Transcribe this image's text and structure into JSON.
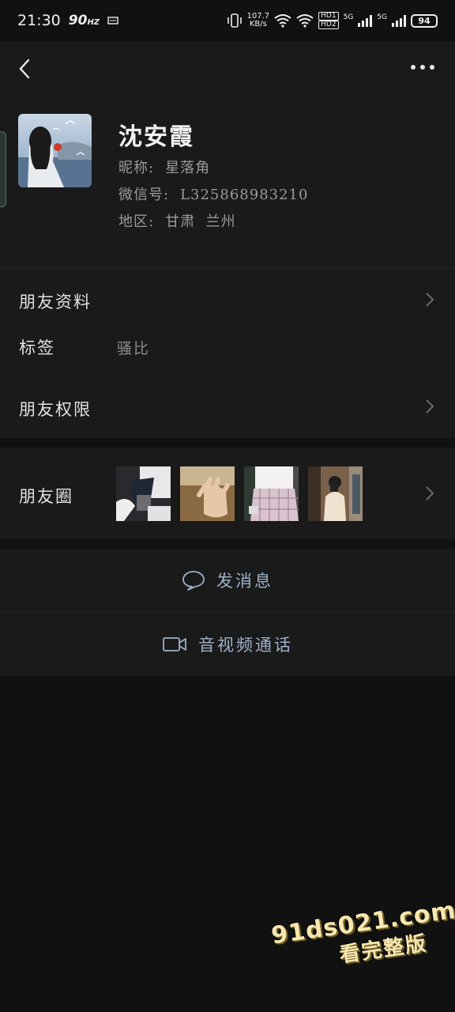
{
  "status_bar": {
    "time": "21:30",
    "refresh_rate": "90",
    "refresh_unit": "HZ",
    "net_speed_value": "107.7",
    "net_speed_unit": "KB/s",
    "hd1": "HD1",
    "hd2": "HD2",
    "sim1_type": "5G",
    "sim2_type": "5G",
    "battery": "94"
  },
  "profile": {
    "name": "沈安霞",
    "nickname_label": "昵称:",
    "nickname": "星落角",
    "wechat_id_label": "微信号:",
    "wechat_id": "L325868983210",
    "region_label": "地区:",
    "region": "甘肃  兰州"
  },
  "rows": {
    "friend_info": "朋友资料",
    "tags_label": "标签",
    "tags_value": "骚比",
    "friend_permissions": "朋友权限",
    "moments": "朋友圈"
  },
  "actions": {
    "send_message": "发消息",
    "video_call": "音视频通话"
  },
  "watermark": {
    "url": "91ds021.com",
    "tagline": "看完整版"
  },
  "icons": [
    "back-icon",
    "more-icon",
    "chevron-right-icon",
    "chat-bubble-icon",
    "video-camera-icon",
    "wifi-icon",
    "vibrate-icon",
    "signal-icon"
  ]
}
